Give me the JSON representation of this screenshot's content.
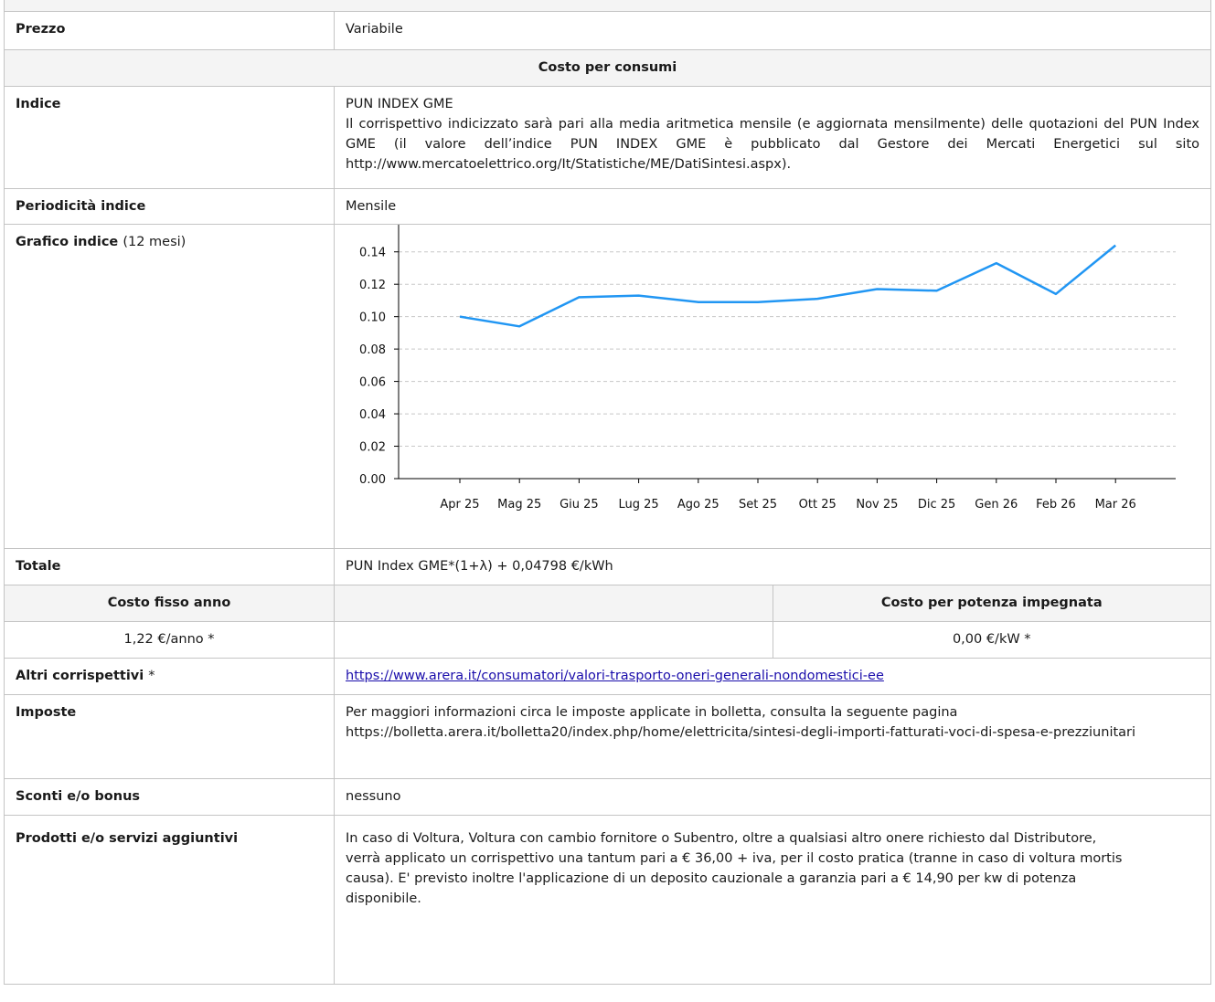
{
  "rows": {
    "prezzo": {
      "label": "Prezzo",
      "value": "Variabile"
    },
    "section_consumi": "Costo per consumi",
    "indice": {
      "label": "Indice",
      "name": "PUN INDEX GME",
      "description": "Il corrispettivo indicizzato sarà pari alla media aritmetica mensile (e aggiornata mensilmente) delle quotazioni del PUN Index GME (il valore dell’indice PUN INDEX GME è pubblicato dal Gestore dei Mercati Energetici sul sito http://www.mercatoelettrico.org/It/Statistiche/ME/DatiSintesi.aspx)."
    },
    "periodicita": {
      "label": "Periodicità indice",
      "value": "Mensile"
    },
    "grafico": {
      "label": "Grafico indice",
      "label_suffix": "(12 mesi)"
    },
    "totale": {
      "label": "Totale",
      "value": "PUN Index GME*(1+λ) + 0,04798 €/kWh"
    },
    "costi": {
      "fisso_header": "Costo fisso anno",
      "potenza_header": "Costo per potenza impegnata",
      "fisso_value": "1,22 €/anno *",
      "potenza_value": "0,00 €/kW *"
    },
    "altri": {
      "label": "Altri corrispettivi",
      "label_suffix": "*",
      "link": "https://www.arera.it/consumatori/valori-trasporto-oneri-generali-nondomestici-ee"
    },
    "imposte": {
      "label": "Imposte",
      "line1": "Per maggiori informazioni circa le imposte applicate in bolletta, consulta la seguente pagina",
      "line2": "https://bolletta.arera.it/bolletta20/index.php/home/elettricita/sintesi-degli-importi-fatturati-voci-di-spesa-e-prezziunitari"
    },
    "sconti": {
      "label": "Sconti e/o bonus",
      "value": "nessuno"
    },
    "prodotti": {
      "label": "Prodotti e/o servizi aggiuntivi",
      "p1": "In caso di Voltura, Voltura con cambio fornitore o Subentro, oltre a qualsiasi altro onere richiesto dal Distributore,",
      "p2": "verrà applicato un corrispettivo una tantum pari a € 36,00 + iva, per il costo pratica (tranne in caso di voltura mortis",
      "p3": "causa). E' previsto inoltre l'applicazione di un deposito cauzionale a garanzia pari a € 14,90 per kw di potenza",
      "p4": "disponibile."
    }
  },
  "chart_data": {
    "type": "line",
    "categories": [
      "Apr 25",
      "Mag 25",
      "Giu 25",
      "Lug 25",
      "Ago 25",
      "Set 25",
      "Ott 25",
      "Nov 25",
      "Dic 25",
      "Gen 26",
      "Feb 26",
      "Mar 26"
    ],
    "values": [
      0.1,
      0.094,
      0.112,
      0.113,
      0.109,
      0.109,
      0.111,
      0.117,
      0.116,
      0.133,
      0.114,
      0.144
    ],
    "yticks": [
      "0.00",
      "0.02",
      "0.04",
      "0.06",
      "0.08",
      "0.10",
      "0.12",
      "0.14"
    ],
    "ylim": [
      0,
      0.15
    ],
    "grid": true,
    "line_color": "#2196f3",
    "grid_color": "#c8c8c8"
  }
}
